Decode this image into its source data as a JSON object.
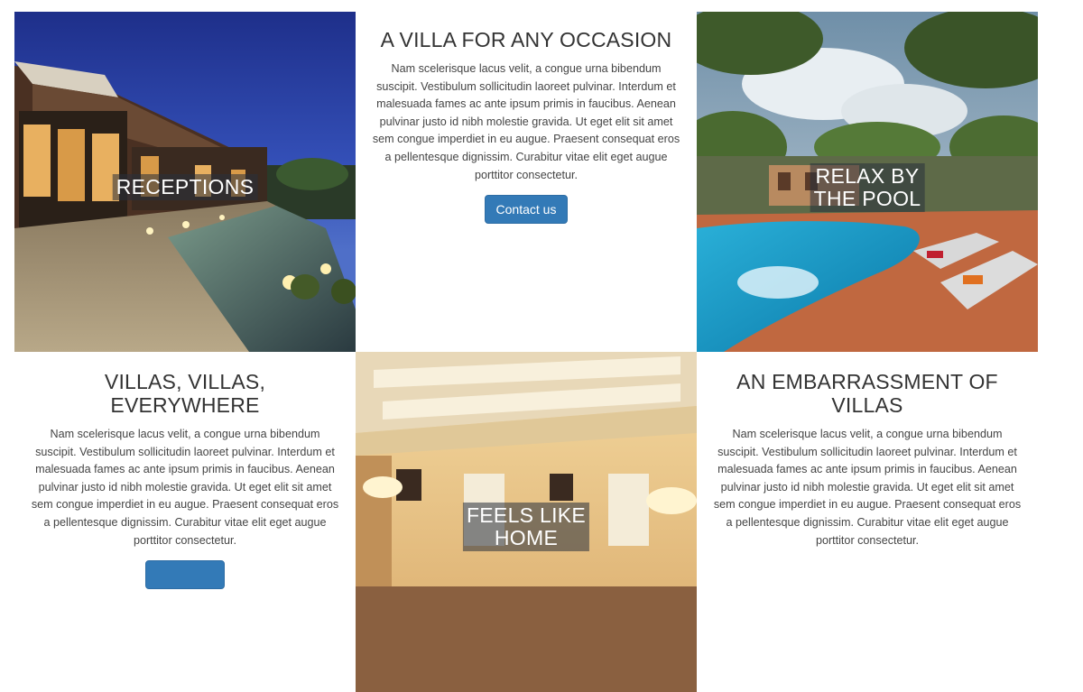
{
  "tiles": {
    "receptions": {
      "caption": "RECEPTIONS"
    },
    "occasion": {
      "title": "A VILLA FOR ANY OCCASION",
      "body": "Nam scelerisque lacus velit, a congue urna bibendum suscipit. Vestibulum sollicitudin laoreet pulvinar. Interdum et malesuada fames ac ante ipsum primis in faucibus. Aenean pulvinar justo id nibh molestie gravida. Ut eget elit sit amet sem congue imperdiet in eu augue. Praesent consequat eros a pellentesque dignissim. Curabitur vitae elit eget augue porttitor consectetur.",
      "button_label": "Contact us"
    },
    "pool": {
      "caption_line1": "RELAX BY",
      "caption_line2": "THE POOL"
    },
    "everywhere": {
      "title": "VILLAS, VILLAS, EVERYWHERE",
      "body": "Nam scelerisque lacus velit, a congue urna bibendum suscipit. Vestibulum sollicitudin laoreet pulvinar. Interdum et malesuada fames ac ante ipsum primis in faucibus. Aenean pulvinar justo id nibh molestie gravida. Ut eget elit sit amet sem congue imperdiet in eu augue. Praesent consequat eros a pellentesque dignissim. Curabitur vitae elit eget augue porttitor consectetur."
    },
    "home": {
      "caption_line1": "FEELS LIKE",
      "caption_line2": "HOME"
    },
    "embarrassment": {
      "title": "AN EMBARRASSMENT OF VILLAS",
      "body": "Nam scelerisque lacus velit, a congue urna bibendum suscipit. Vestibulum sollicitudin laoreet pulvinar. Interdum et malesuada fames ac ante ipsum primis in faucibus. Aenean pulvinar justo id nibh molestie gravida. Ut eget elit sit amet sem congue imperdiet in eu augue. Praesent consequat eros a pellentesque dignissim. Curabitur vitae elit eget augue porttitor consectetur."
    }
  },
  "colors": {
    "button": "#337ab7",
    "heading": "#333333",
    "body_text": "#444444",
    "caption_bg": "#28303c"
  }
}
